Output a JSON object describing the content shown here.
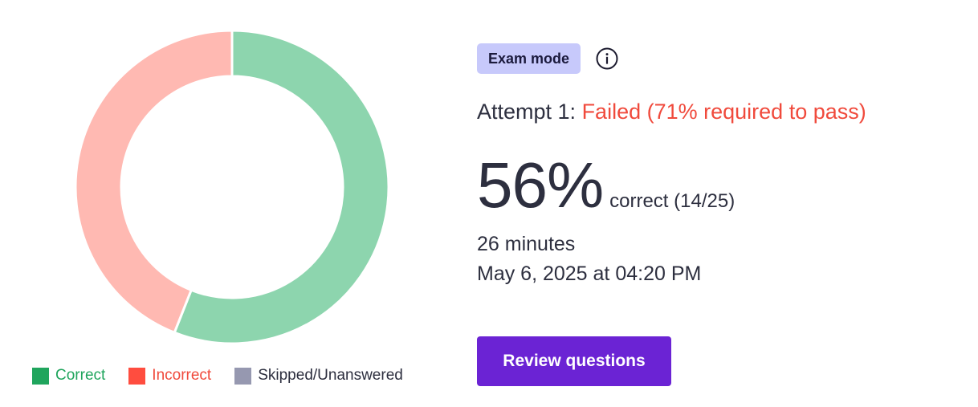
{
  "colors": {
    "correct": "#8dd5ae",
    "incorrect": "#ffb9b2",
    "skipped": "#9698b0",
    "legend_correct": "#20a55d",
    "legend_incorrect": "#f04a3c",
    "status_failed": "#f04a3c",
    "badge_bg": "#c7c9fb",
    "button_bg": "#6b23d4"
  },
  "chart_data": {
    "type": "pie",
    "style": "donut",
    "categories": [
      "Correct",
      "Incorrect",
      "Skipped/Unanswered"
    ],
    "values": [
      14,
      11,
      0
    ],
    "legend_placement": "bottom"
  },
  "legend": {
    "correct": "Correct",
    "incorrect": "Incorrect",
    "skipped": "Skipped/Unanswered"
  },
  "header": {
    "badge": "Exam mode",
    "info_icon": "info-icon"
  },
  "attempt": {
    "label": "Attempt 1: ",
    "status": "Failed (71% required to pass)"
  },
  "score": {
    "percent": "56%",
    "detail": "correct (14/25)"
  },
  "duration": "26 minutes",
  "datetime": "May 6, 2025 at 04:20 PM",
  "actions": {
    "review_label": "Review questions"
  }
}
